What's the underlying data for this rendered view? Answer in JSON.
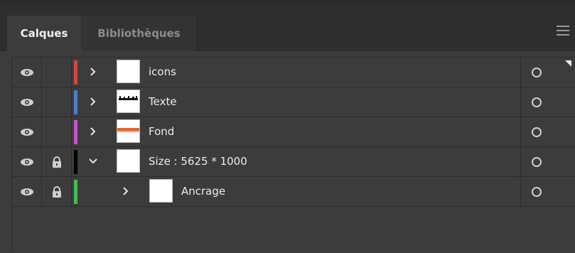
{
  "tabs": [
    {
      "label": "Calques"
    },
    {
      "label": "Bibliothèques"
    }
  ],
  "layers": [
    {
      "name": "icons",
      "color": "#e04040",
      "expanded": false,
      "locked": false,
      "visible": true,
      "thumbnail": "blank"
    },
    {
      "name": "Texte",
      "color": "#4a7bd8",
      "expanded": false,
      "locked": false,
      "visible": true,
      "thumbnail": "text"
    },
    {
      "name": "Fond",
      "color": "#d04ad8",
      "expanded": false,
      "locked": false,
      "visible": true,
      "thumbnail": "orange-band"
    },
    {
      "name": "Size : 5625 * 1000",
      "color": "#000000",
      "expanded": true,
      "locked": true,
      "visible": true,
      "thumbnail": "blank"
    },
    {
      "name": "Ancrage",
      "color": "#35c64a",
      "expanded": false,
      "locked": true,
      "visible": true,
      "thumbnail": "blank",
      "indent": 1
    }
  ],
  "icons": {
    "visibility": "eye-icon",
    "lock": "lock-icon",
    "expand": "chevron-right-icon",
    "collapse": "chevron-down-icon",
    "target": "target-circle-icon",
    "menu": "hamburger-menu-icon"
  }
}
